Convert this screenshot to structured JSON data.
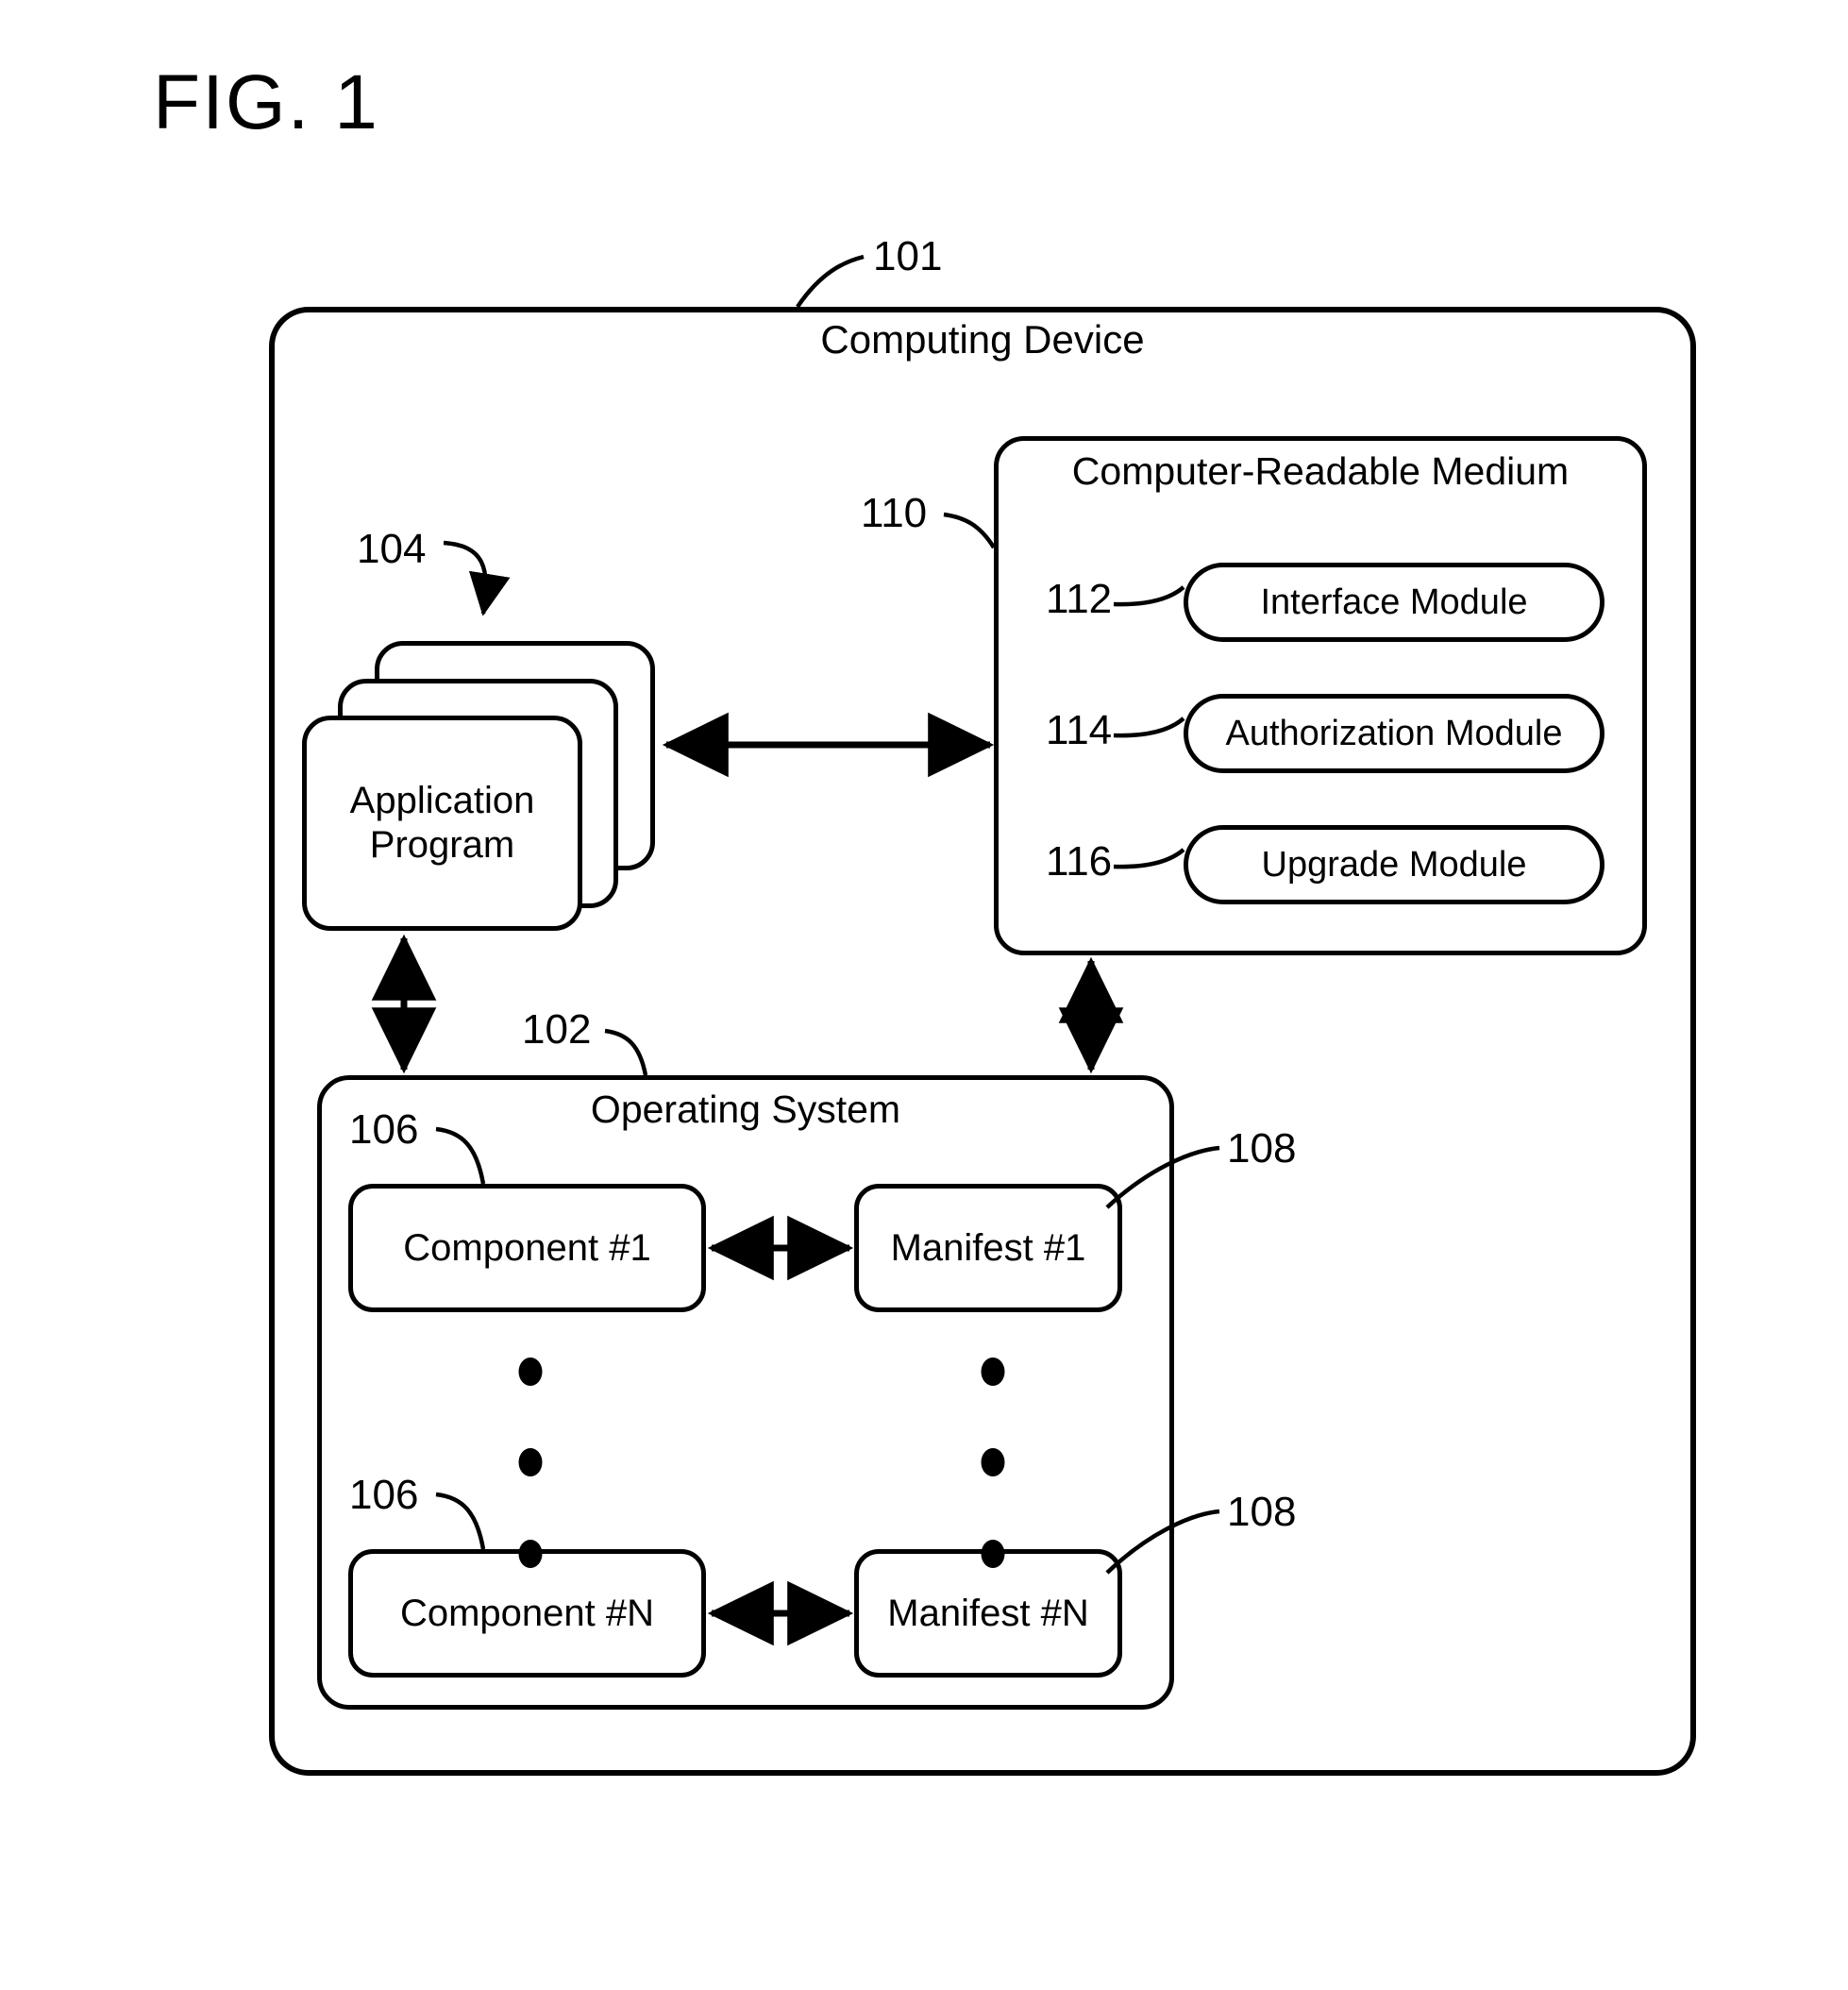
{
  "figure": {
    "title": "FIG. 1",
    "domain_type": "patent-block-diagram"
  },
  "computing_device": {
    "ref": "101",
    "title": "Computing Device"
  },
  "computer_readable_medium": {
    "ref": "110",
    "title": "Computer-Readable Medium",
    "modules": [
      {
        "ref": "112",
        "label": "Interface Module"
      },
      {
        "ref": "114",
        "label": "Authorization Module"
      },
      {
        "ref": "116",
        "label": "Upgrade Module"
      }
    ]
  },
  "application_program": {
    "ref": "104",
    "label": "Application\nProgram",
    "label_line1": "Application",
    "label_line2": "Program",
    "stack_count": 3
  },
  "operating_system": {
    "ref": "102",
    "title": "Operating System",
    "rows": [
      {
        "component_ref": "106",
        "component_label": "Component #1",
        "manifest_ref": "108",
        "manifest_label": "Manifest #1"
      },
      {
        "component_ref": "106",
        "component_label": "Component #N",
        "manifest_ref": "108",
        "manifest_label": "Manifest #N"
      }
    ],
    "ellipsis_dots_per_column": 3,
    "ellipsis_columns": 2
  },
  "connections": [
    {
      "name": "application-to-medium",
      "kind": "double-arrow",
      "orientation": "horizontal"
    },
    {
      "name": "application-to-operating-system",
      "kind": "double-arrow",
      "orientation": "vertical"
    },
    {
      "name": "medium-to-operating-system",
      "kind": "double-arrow",
      "orientation": "vertical"
    },
    {
      "name": "component1-to-manifest1",
      "kind": "double-arrow",
      "orientation": "horizontal"
    },
    {
      "name": "componentN-to-manifestN",
      "kind": "double-arrow",
      "orientation": "horizontal"
    }
  ],
  "colors": {
    "stroke": "#000000",
    "background": "#ffffff"
  }
}
